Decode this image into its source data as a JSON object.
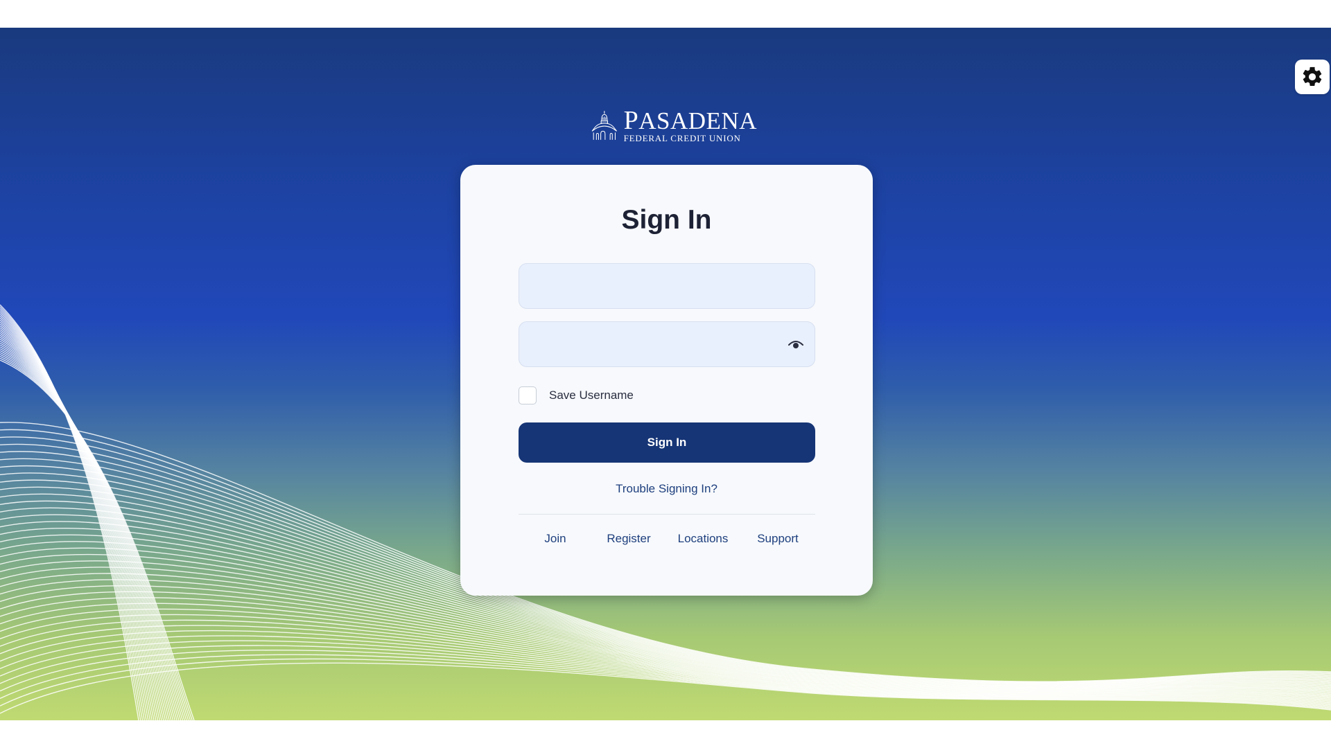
{
  "brand": {
    "name_first_letter": "P",
    "name_rest": "ASADENA",
    "subtitle": "FEDERAL CREDIT UNION"
  },
  "card": {
    "title": "Sign In",
    "username_placeholder": "",
    "password_placeholder": "",
    "save_username_label": "Save Username",
    "save_username_checked": false,
    "signin_button_label": "Sign In",
    "trouble_link_label": "Trouble Signing In?"
  },
  "footer_links": [
    {
      "label": "Join"
    },
    {
      "label": "Register"
    },
    {
      "label": "Locations"
    },
    {
      "label": "Support"
    }
  ],
  "icons": {
    "settings": "gear-icon",
    "password_toggle": "eye-icon",
    "logo": "dome-logo-icon"
  },
  "colors": {
    "primary": "#163576",
    "link": "#1e3f7e",
    "gradient_top": "#1a3a7e",
    "gradient_mid": "#2148b9",
    "gradient_bottom": "#c0da72"
  }
}
